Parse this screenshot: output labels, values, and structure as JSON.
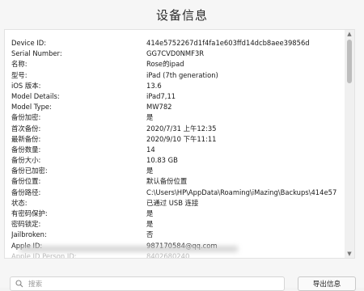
{
  "window": {
    "title": "设备信息"
  },
  "info_rows": [
    {
      "label": "Device ID:",
      "value": "414e5752267d1f4fa1e603ffd14dcb8aee39856d"
    },
    {
      "label": "Serial Number:",
      "value": "GG7CVD0NMF3R"
    },
    {
      "label": "名称:",
      "value": "Rose的ipad"
    },
    {
      "label": "型号:",
      "value": "iPad (7th generation)"
    },
    {
      "label": "iOS 版本:",
      "value": "13.6"
    },
    {
      "label": "Model Details:",
      "value": "iPad7,11"
    },
    {
      "label": "Model Type:",
      "value": "MW782"
    },
    {
      "label": "备份加密:",
      "value": "是"
    },
    {
      "label": "首次备份:",
      "value": "2020/7/31 上午12:35"
    },
    {
      "label": "最新备份:",
      "value": "2020/9/10 下午11:11"
    },
    {
      "label": "备份数量:",
      "value": "14"
    },
    {
      "label": "备份大小:",
      "value": "10.83 GB"
    },
    {
      "label": "备份已加密:",
      "value": "是"
    },
    {
      "label": "备份位置:",
      "value": "默认备份位置"
    },
    {
      "label": "备份路径:",
      "value": "C:\\Users\\HP\\AppData\\Roaming\\iMazing\\Backups\\414e57"
    },
    {
      "label": "状态:",
      "value": "已通过 USB 连接"
    },
    {
      "label": "有密码保护:",
      "value": "是"
    },
    {
      "label": "密码锁定:",
      "value": "是"
    },
    {
      "label": "Jailbroken:",
      "value": "否"
    },
    {
      "label": "Apple ID:",
      "value": "987170584@qq.com"
    },
    {
      "label": "Apple ID Person ID:",
      "value": "8402680240"
    }
  ],
  "search": {
    "placeholder": "搜索",
    "icon": "search-icon"
  },
  "export_button": {
    "label": "导出信息"
  }
}
